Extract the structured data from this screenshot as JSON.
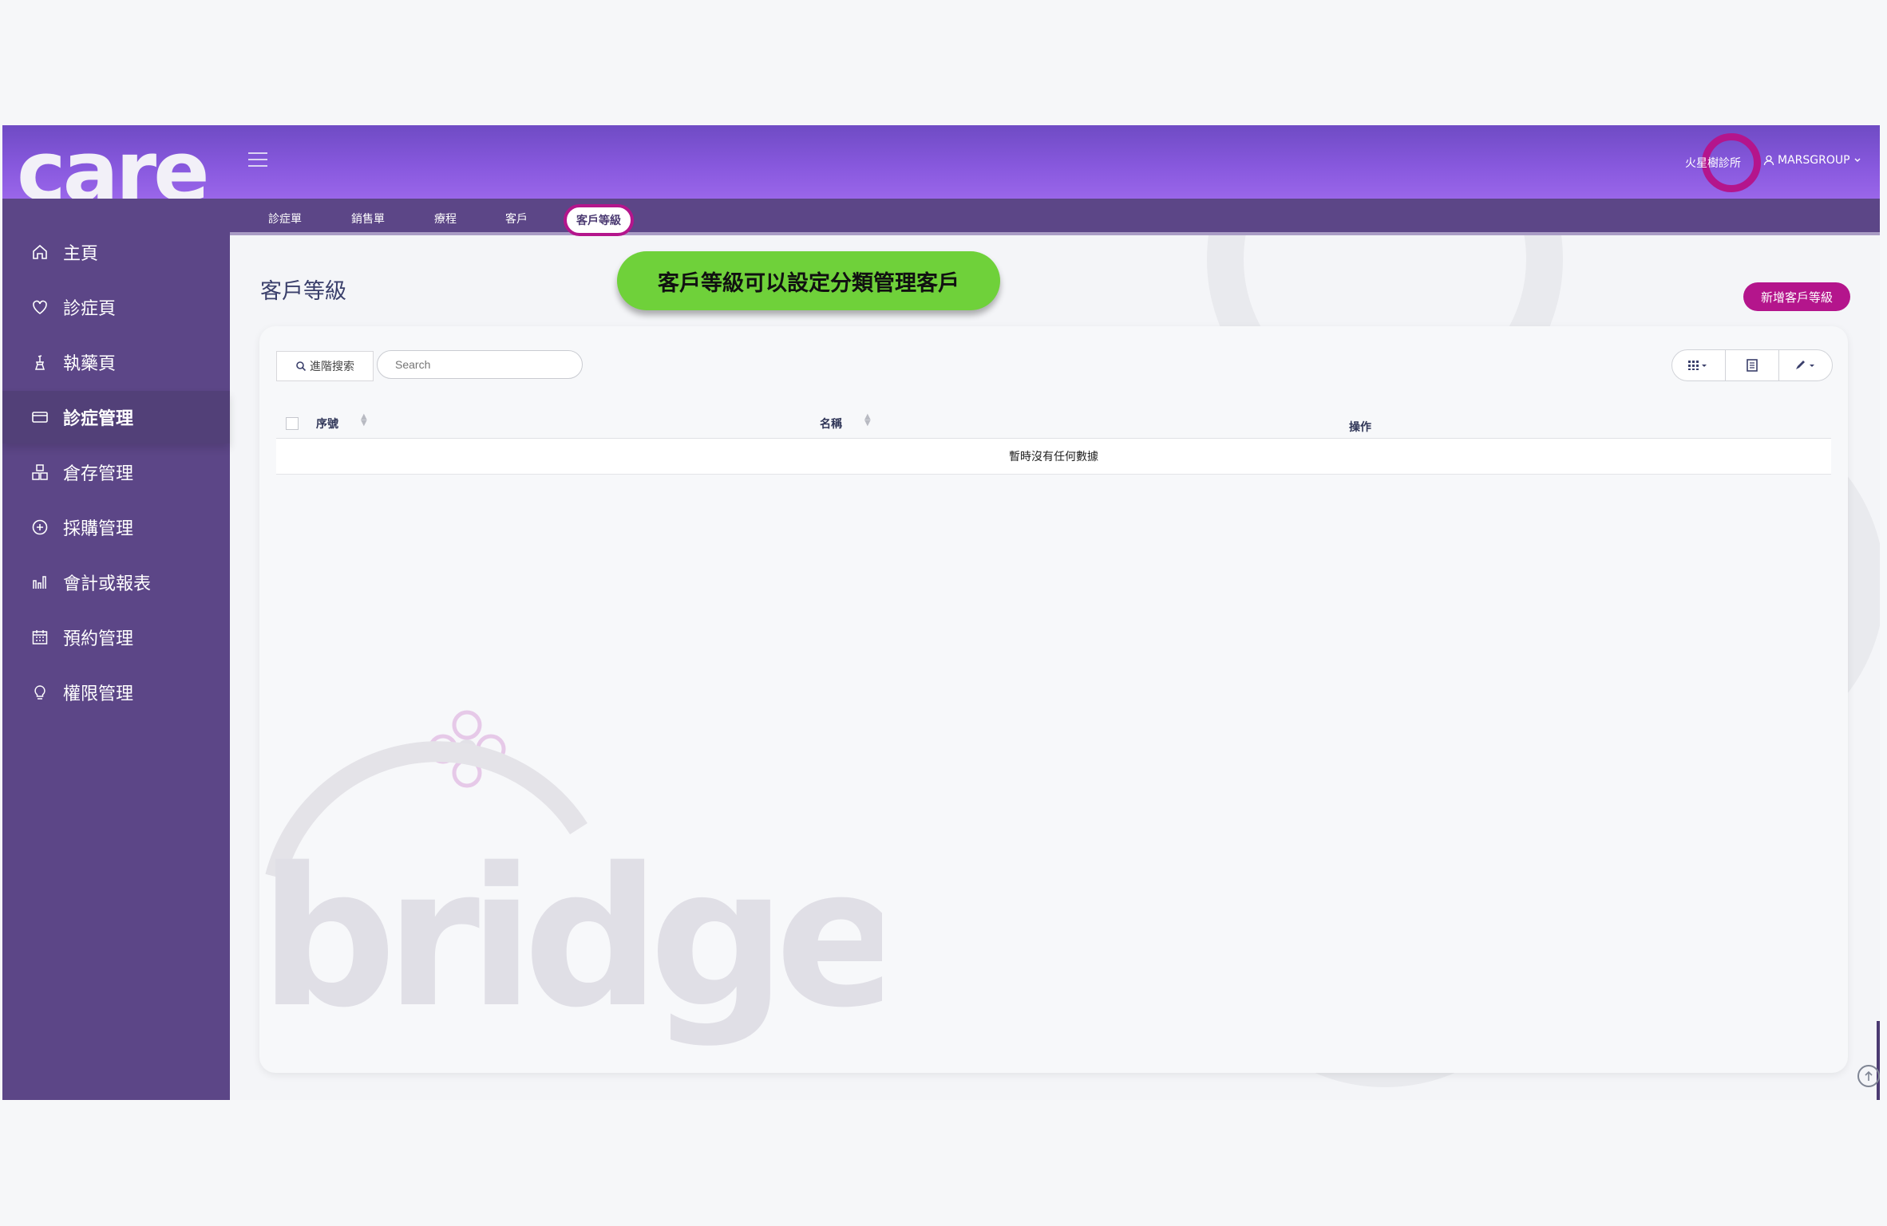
{
  "app": {
    "logo_text": "care",
    "clinic_name": "火星樹診所",
    "user_name": "MARSGROUP"
  },
  "sidebar": {
    "items": [
      {
        "label": "主頁",
        "icon": "home-icon"
      },
      {
        "label": "診症頁",
        "icon": "heart-icon"
      },
      {
        "label": "執藥頁",
        "icon": "pestle-icon"
      },
      {
        "label": "診症管理",
        "icon": "card-icon",
        "active": true
      },
      {
        "label": "倉存管理",
        "icon": "boxes-icon"
      },
      {
        "label": "採購管理",
        "icon": "plus-circle-icon"
      },
      {
        "label": "會計或報表",
        "icon": "bar-chart-icon"
      },
      {
        "label": "預約管理",
        "icon": "calendar-icon"
      },
      {
        "label": "權限管理",
        "icon": "bulb-icon"
      }
    ]
  },
  "tabs": [
    {
      "label": "診症單"
    },
    {
      "label": "銷售單"
    },
    {
      "label": "療程"
    },
    {
      "label": "客戶"
    },
    {
      "label": "客戶等級",
      "active": true
    }
  ],
  "page": {
    "title": "客戶等級",
    "callout": "客戶等級可以設定分類管理客戶",
    "add_button": "新增客戶等級"
  },
  "search": {
    "advanced_label": "進階搜索",
    "placeholder": "Search",
    "value": ""
  },
  "table": {
    "columns": [
      "序號",
      "名稱",
      "操作"
    ],
    "rows": [],
    "empty_text": "暫時沒有任何數據"
  },
  "watermark": {
    "text": "bridge"
  },
  "colors": {
    "accent": "#b4158c",
    "sidebar": "#5c4687",
    "header_start": "#6f4bc4",
    "header_end": "#9a66ea",
    "callout": "#6fd13a",
    "title": "#3a3f6b"
  }
}
